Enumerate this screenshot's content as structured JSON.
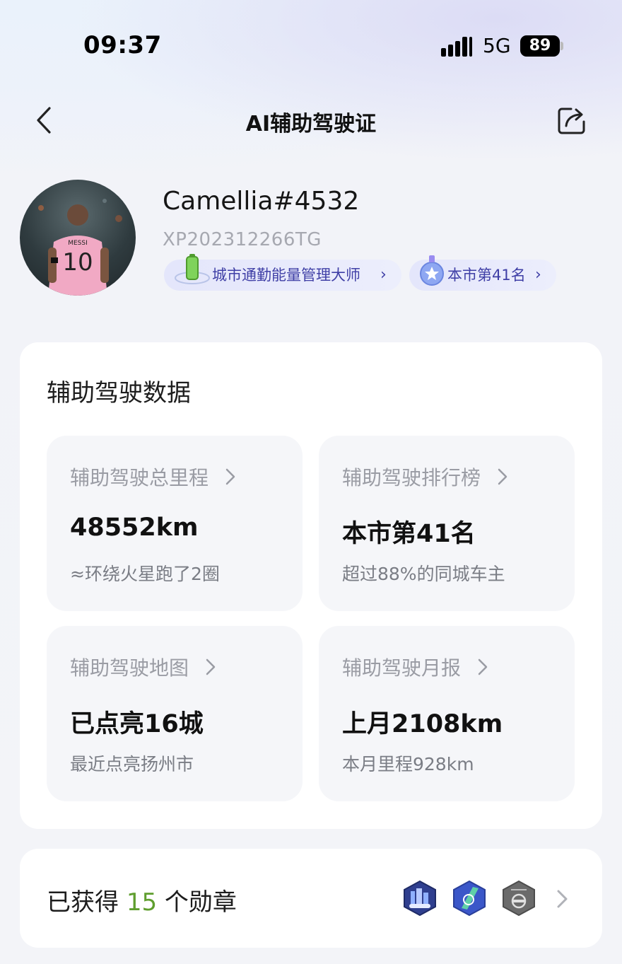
{
  "status_bar": {
    "time": "09:37",
    "network": "5G",
    "battery": "89"
  },
  "header": {
    "title": "AI辅助驾驶证"
  },
  "profile": {
    "username": "Camellia#4532",
    "id": "XP202312266TG",
    "avatar_jersey_name": "MESSI",
    "avatar_jersey_number": "10",
    "tags": [
      {
        "label": "城市通勤能量管理大师"
      },
      {
        "label": "本市第41名"
      }
    ]
  },
  "driving_data": {
    "title": "辅助驾驶数据",
    "tiles": [
      {
        "label": "辅助驾驶总里程",
        "value": "48552km",
        "sub": "≈环绕火星跑了2圈"
      },
      {
        "label": "辅助驾驶排行榜",
        "value": "本市第41名",
        "sub": "超过88%的同城车主"
      },
      {
        "label": "辅助驾驶地图",
        "value": "已点亮16城",
        "sub": "最近点亮扬州市"
      },
      {
        "label": "辅助驾驶月报",
        "value": "上月2108km",
        "sub": "本月里程928km"
      }
    ]
  },
  "badges": {
    "prefix": "已获得",
    "count": "15",
    "suffix": "个勋章",
    "count_color": "#5f9e2e"
  },
  "icons": {
    "back": "chevron-left-icon",
    "share": "share-icon",
    "tile_chevron": "chevron-right-icon"
  }
}
